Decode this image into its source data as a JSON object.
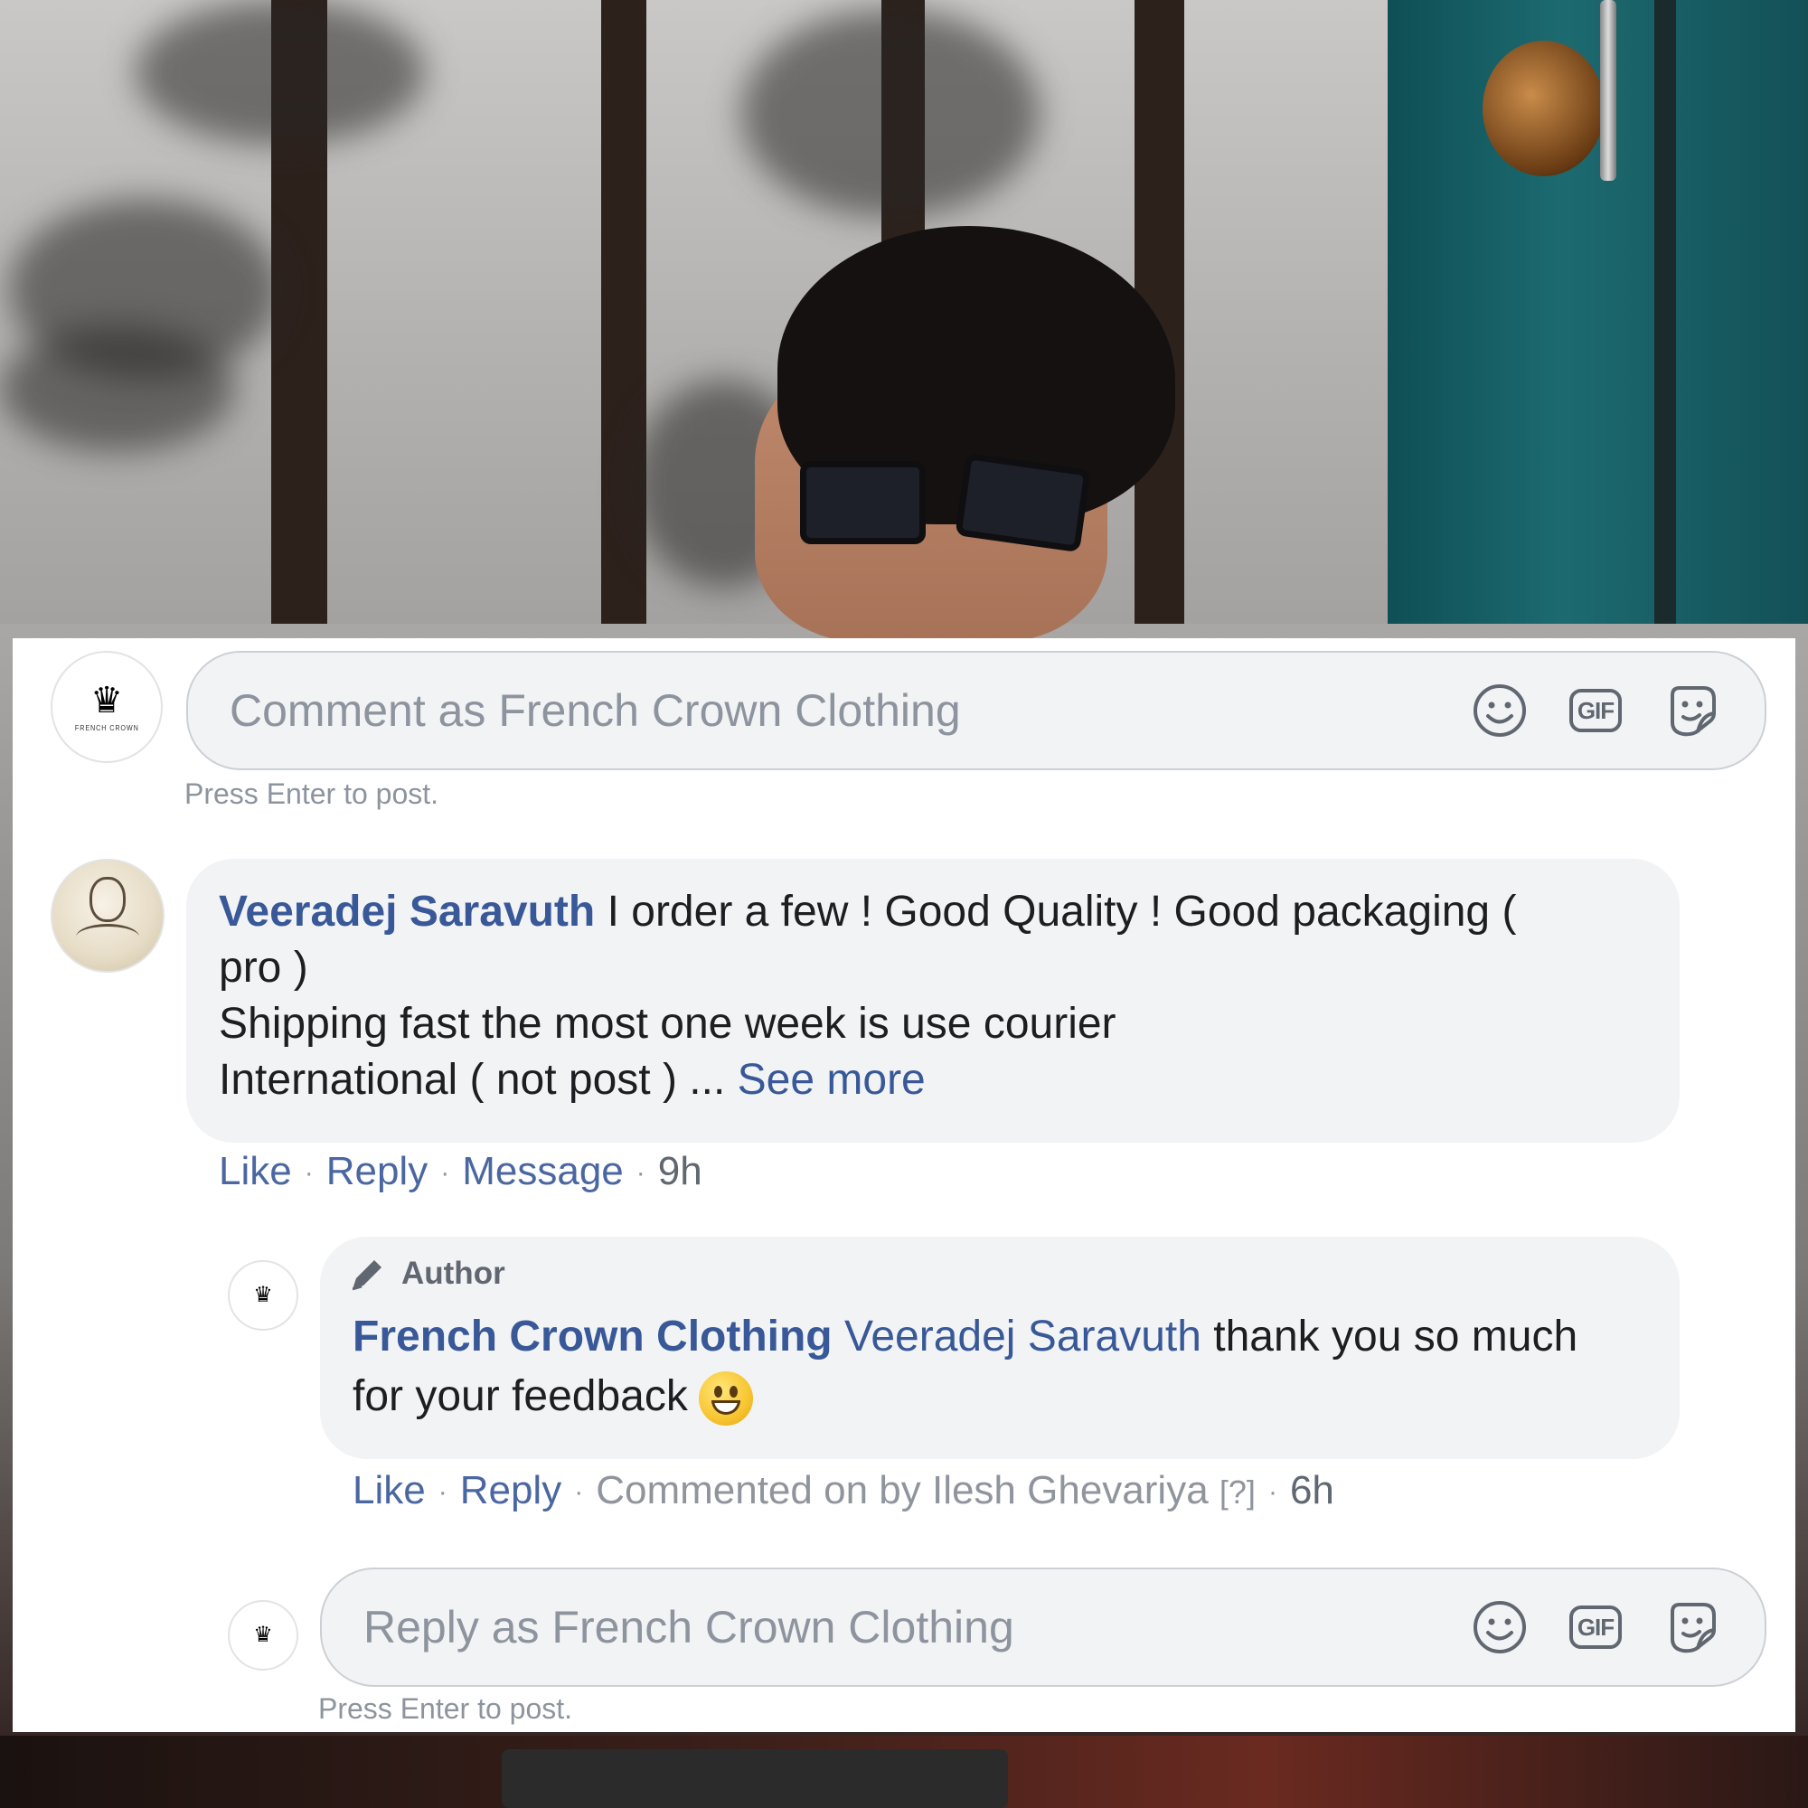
{
  "comment_box": {
    "placeholder": "Comment as French Crown Clothing",
    "hint": "Press Enter to post.",
    "icons": [
      "smiley-icon",
      "gif-icon",
      "sticker-icon"
    ],
    "gif_label": "GIF"
  },
  "comment": {
    "author": "Veeradej Saravuth",
    "line1": " I order a few ! Good Quality ! Good packaging (",
    "line2": "pro )",
    "line3": "Shipping fast the most one week is use courier",
    "line4": "International ( not post ) ... ",
    "see_more": "See more",
    "actions": {
      "like": "Like",
      "reply": "Reply",
      "message": "Message",
      "time": "9h"
    }
  },
  "reply": {
    "badge": "Author",
    "author": "French Crown Clothing",
    "mention": "Veeradej Saravuth",
    "text_line1": " thank you so much",
    "text_line2": "for your feedback",
    "emoji": "grinning-face-emoji",
    "actions": {
      "like": "Like",
      "reply": "Reply",
      "commented_on_by": "Commented on by Ilesh Ghevariya",
      "help": "[?]",
      "time": "6h"
    }
  },
  "reply_box": {
    "placeholder": "Reply as French Crown Clothing",
    "hint": "Press Enter to post.",
    "gif_label": "GIF"
  },
  "colors": {
    "link_blue": "#385898",
    "bubble_grey": "#f2f3f5",
    "muted_text": "#8d949e"
  }
}
